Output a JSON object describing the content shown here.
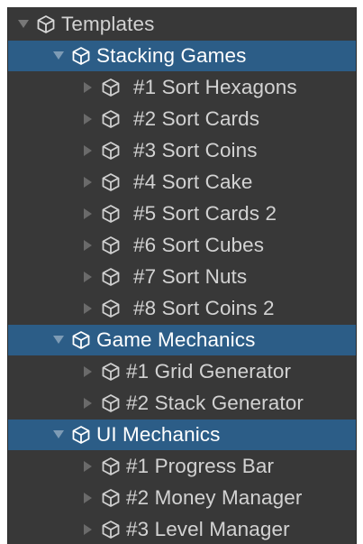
{
  "tree": {
    "root": {
      "label": "Templates",
      "expanded": true,
      "icon": "prefab-cube-icon"
    },
    "groups": [
      {
        "label": "Stacking Games",
        "expanded": true,
        "selected": true,
        "items": [
          {
            "label": "#1 Sort Hexagons"
          },
          {
            "label": "#2 Sort Cards"
          },
          {
            "label": "#3 Sort Coins"
          },
          {
            "label": "#4 Sort Cake"
          },
          {
            "label": "#5 Sort Cards 2"
          },
          {
            "label": "#6 Sort Cubes"
          },
          {
            "label": "#7 Sort Nuts"
          },
          {
            "label": "#8 Sort Coins 2"
          }
        ]
      },
      {
        "label": "Game Mechanics",
        "expanded": true,
        "selected": true,
        "items": [
          {
            "label": "#1 Grid Generator"
          },
          {
            "label": "#2 Stack Generator"
          }
        ]
      },
      {
        "label": "UI Mechanics",
        "expanded": true,
        "selected": true,
        "items": [
          {
            "label": "#1 Progress Bar"
          },
          {
            "label": "#2 Money Manager"
          },
          {
            "label": "#3 Level Manager"
          }
        ]
      }
    ]
  },
  "colors": {
    "panel_bg": "#383838",
    "selection_bg": "#2c5d87",
    "text": "#d2d2d2",
    "selected_text": "#ffffff",
    "arrow": "#6f6f6f"
  }
}
